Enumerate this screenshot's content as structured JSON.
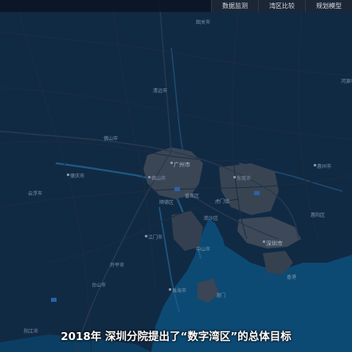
{
  "nav": {
    "tabs": [
      "数据监测",
      "湾区比较",
      "规划模型"
    ]
  },
  "caption": "2018年 深圳分院提出了“数字湾区”的总体目标",
  "map": {
    "places": {
      "qingyuan": "清远市",
      "foshan_n": "佛山市",
      "guangzhou": "广州市",
      "zhaoqing": "肇庆市",
      "yunfu": "云浮市",
      "foshan": "佛山市",
      "dongguan": "东莞市",
      "huizhou": "惠州市",
      "jiangmen": "江门市",
      "zhongshan": "中山市",
      "shenzhen": "深圳市",
      "hongkong": "香港",
      "zhuhai": "珠海市",
      "macau": "澳门",
      "yangjiang": "阳江市",
      "heyuan": "河源市",
      "shaoguan": "韶关市",
      "kaiping": "开平市",
      "taishan": "台山市",
      "huiyang": "惠阳区",
      "nansha": "南沙区",
      "shunde": "顺德区",
      "panyu": "番禺区",
      "humen": "虎门镇"
    },
    "colors": {
      "land": "#112a44",
      "water": "#0c4a74",
      "urban": "#3b4655",
      "road": "#1e2c3e"
    }
  }
}
